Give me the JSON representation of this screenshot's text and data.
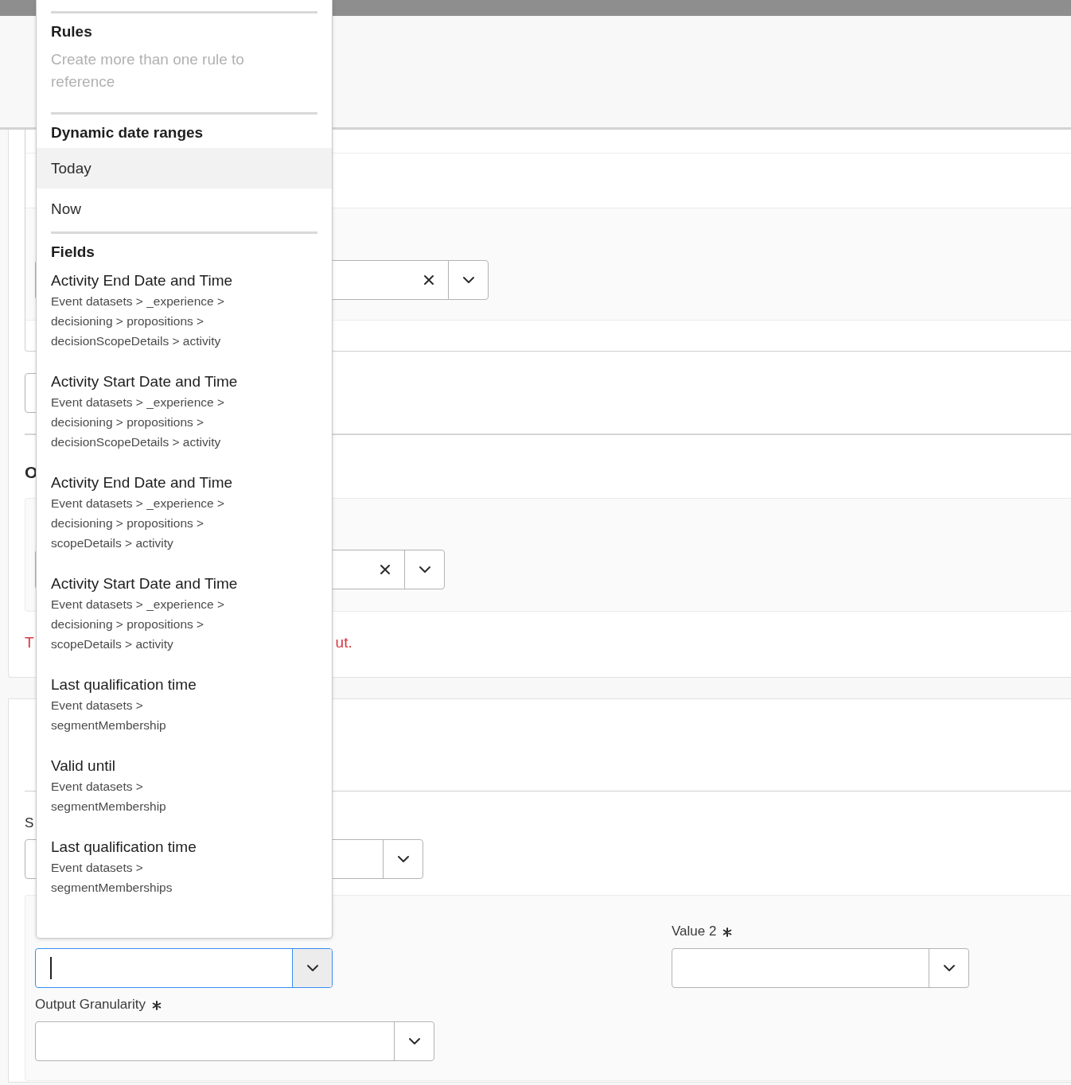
{
  "dropdown": {
    "sections": [
      {
        "heading": "Rules",
        "items": [
          {
            "kind": "note",
            "label": "Create more than one rule to reference",
            "highlighted": false
          }
        ]
      },
      {
        "heading": "Dynamic date ranges",
        "items": [
          {
            "kind": "option",
            "label": "Today",
            "highlighted": true
          },
          {
            "kind": "option",
            "label": "Now",
            "highlighted": false
          }
        ]
      },
      {
        "heading": "Fields",
        "items": [
          {
            "kind": "field",
            "label": "Activity End Date and Time",
            "path": "Event datasets > _experience > decisioning > propositions > decisionScopeDetails > activity",
            "highlighted": false
          },
          {
            "kind": "field",
            "label": "Activity Start Date and Time",
            "path": "Event datasets > _experience > decisioning > propositions > decisionScopeDetails > activity",
            "highlighted": false
          },
          {
            "kind": "field",
            "label": "Activity End Date and Time",
            "path": "Event datasets > _experience > decisioning > propositions > scopeDetails > activity",
            "highlighted": false
          },
          {
            "kind": "field",
            "label": "Activity Start Date and Time",
            "path": "Event datasets > _experience > decisioning > propositions > scopeDetails > activity",
            "highlighted": false
          },
          {
            "kind": "field",
            "label": "Last qualification time",
            "path": "Event datasets > segmentMembership",
            "highlighted": false
          },
          {
            "kind": "field",
            "label": "Valid until",
            "path": "Event datasets > segmentMembership",
            "highlighted": false
          },
          {
            "kind": "field",
            "label": "Last qualification time",
            "path": "Event datasets > segmentMemberships",
            "highlighted": false
          }
        ]
      }
    ]
  },
  "form": {
    "section_heading": "O",
    "error_text_start": "T",
    "error_text_end": "ut.",
    "label_partial": "S",
    "value_2": {
      "label": "Value 2",
      "required": true
    },
    "output_granularity": {
      "label": "Output Granularity",
      "required": true
    },
    "comboboxes": [
      {
        "clearable": true,
        "focused": false
      },
      {
        "clearable": true,
        "focused": false
      },
      {
        "clearable": false,
        "focused": false
      },
      {
        "clearable": false,
        "focused": true
      },
      {
        "clearable": false,
        "focused": false
      },
      {
        "clearable": false,
        "focused": false
      }
    ]
  }
}
